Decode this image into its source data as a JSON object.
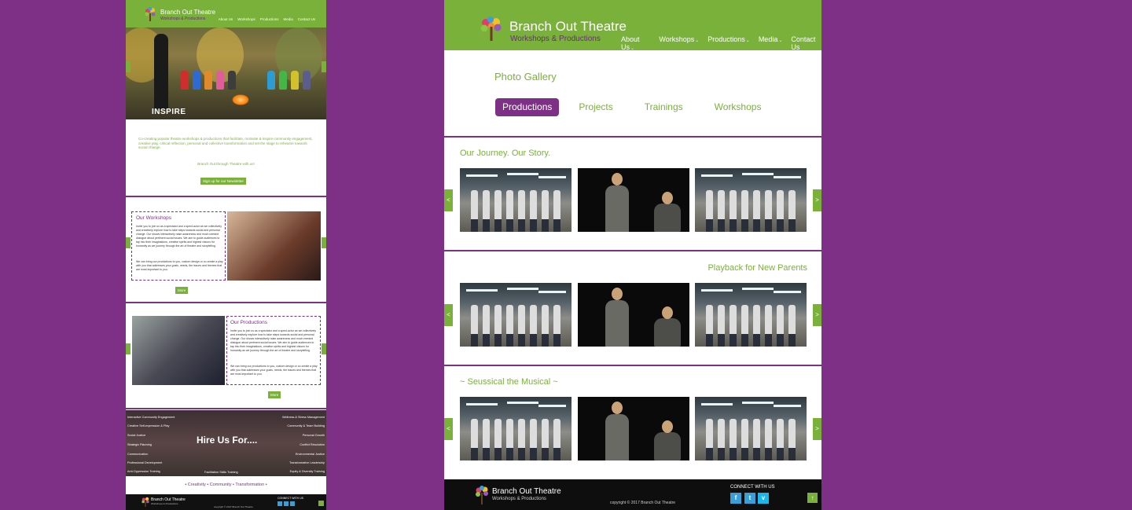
{
  "left": {
    "brand": "Branch Out Theatre",
    "brand_sub": "Workshops & Productions",
    "nav": [
      "About Us",
      "Workshops",
      "Productions",
      "Media",
      "Contact Us"
    ],
    "hero_caption": "INSPIRE",
    "intro_text": "Co-creating popular theatre workshops & productions that facilitate, motivate & inspire community engagement, creative play, critical reflection, personal and collective transformation and set the stage to rehearse towards social change.",
    "join_text": "Branch Out through Theatre with us!",
    "newsletter_btn": "Sign up for our Newsletter",
    "workshops": {
      "title": "Our Workshops",
      "text1": "Invite you to join us as a spectator and a spect-actor as we collectively and creatively explore how to take steps towards social and personal change. Our shows interactively raise awareness and much needed dialogue about pertinent social issues. We aim to guide audiences to tap into their imaginations, creative spirits and highest visions for humanity as we journey through the art of theatre and storytelling.",
      "text2": "We can bring our productions to you, custom design or co-create a play with you that addresses your goals, needs, the issues and themes that are most important to you.",
      "more": "More"
    },
    "productions": {
      "title": "Our Productions",
      "text1": "Invite you to join us as a spectator and a spect-actor as we collectively and creatively explore how to take steps towards social and personal change. Our shows interactively raise awareness and much needed dialogue about pertinent social issues. We aim to guide audiences to tap into their imaginations, creative spirits and highest visions for humanity as we journey through the art of theatre and storytelling.",
      "text2": "We can bring our productions to you, custom design or co-create a play with you that addresses your goals, needs, the issues and themes that are most important to you.",
      "more": "More"
    },
    "hire": {
      "title": "Hire Us For....",
      "left_items": [
        "Interactive Community Engagement",
        "Creative Self-expression & Play",
        "Social Justice",
        "Strategic Planning",
        "Communication",
        "Professional Development",
        "Anti-Oppression Training"
      ],
      "right_items": [
        "Wellness & Stress Management",
        "Community & Team Building",
        "Personal Growth",
        "Conflict Resolution",
        "Environmental Justice",
        "Transformative Leadership",
        "Equity & Diversity Training"
      ],
      "bottom_item": "Facilitation Skills Training"
    },
    "tagline": "• Creativity • Community • Transformation •",
    "footer_brand": "Branch Out Theatre",
    "footer_sub": "Workshops & Productions",
    "footer_copy": "copyright © 2017 Branch Out Theatre",
    "footer_connect": "CONNECT WITH US"
  },
  "right": {
    "brand": "Branch Out Theatre",
    "brand_sub": "Workshops & Productions",
    "nav": [
      {
        "label": "About Us",
        "caret": "⌄"
      },
      {
        "label": "Workshops",
        "caret": "⌄"
      },
      {
        "label": "Productions",
        "caret": "⌄"
      },
      {
        "label": "Media",
        "caret": "⌄"
      },
      {
        "label": "Contact Us",
        "caret": ""
      }
    ],
    "page_title": "Photo Gallery",
    "tabs": [
      "Productions",
      "Projects",
      "Trainings",
      "Workshops"
    ],
    "active_tab": "Productions",
    "sections": [
      {
        "title": "Our Journey. Our Story."
      },
      {
        "title": "Playback for New Parents"
      },
      {
        "title": "~ Seussical the Musical ~"
      }
    ],
    "arrow_prev": "<",
    "arrow_next": ">",
    "footer": {
      "brand": "Branch Out Theatre",
      "sub": "Workshops & Productions",
      "copyright": "copyright © 2017 Branch Out Theatre",
      "connect": "CONNECT WITH US",
      "social": [
        {
          "name": "facebook-icon",
          "glyph": "f"
        },
        {
          "name": "twitter-icon",
          "glyph": "t"
        },
        {
          "name": "vimeo-icon",
          "glyph": "v"
        }
      ],
      "top_glyph": "↑"
    }
  },
  "colors": {
    "purple": "#7e2f86",
    "green": "#7ab13b",
    "footer": "#0e0e0e"
  }
}
